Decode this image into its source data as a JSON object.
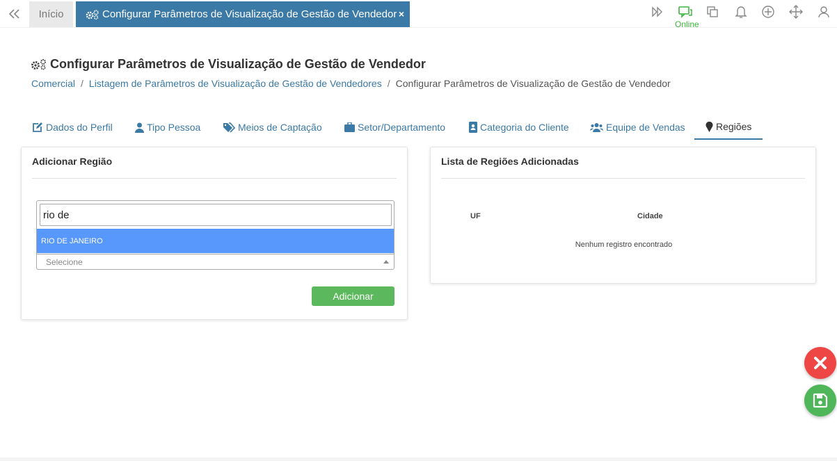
{
  "topbar": {
    "home_tab": "Início",
    "active_tab": "Configurar Parâmetros de Visualização de Gestão de Vendedor",
    "close_symbol": "×",
    "online_label": "Online",
    "icons": [
      "forward-icon",
      "chat-icon",
      "windows-icon",
      "bell-icon",
      "plus-circle-icon",
      "move-icon",
      "user-icon"
    ],
    "online_color": "#3db53d"
  },
  "header": {
    "title": "Configurar Parâmetros de Visualização de Gestão de Vendedor",
    "breadcrumb": {
      "item1": "Comercial",
      "item2": "Listagem de Parâmetros de Visualização de Gestão de Vendedores",
      "current": "Configurar Parâmetros de Visualização de Gestão de Vendedor",
      "separator": "/"
    }
  },
  "tabs": {
    "dados_perfil": "Dados do Perfil",
    "tipo_pessoa": "Tipo Pessoa",
    "meios_captacao": "Meios de Captação",
    "setor": "Setor/Departamento",
    "categoria": "Categoria do Cliente",
    "equipe": "Equipe de Vendas",
    "regioes": "Regiões"
  },
  "left_panel": {
    "title": "Adicionar Região",
    "search_value": "rio de",
    "option": "RIO DE JANEIRO",
    "placeholder": "Selecione",
    "add_button": "Adicionar"
  },
  "right_panel": {
    "title": "Lista de Regiões Adicionadas",
    "col_uf": "UF",
    "col_cidade": "Cidade",
    "empty_message": "Nenhum registro encontrado"
  },
  "colors": {
    "accent": "#3b79a6",
    "option_highlight": "#5897fb",
    "add_button": "#5cb85c",
    "fab_close": "#ee4545",
    "fab_save": "#4fb65a"
  }
}
